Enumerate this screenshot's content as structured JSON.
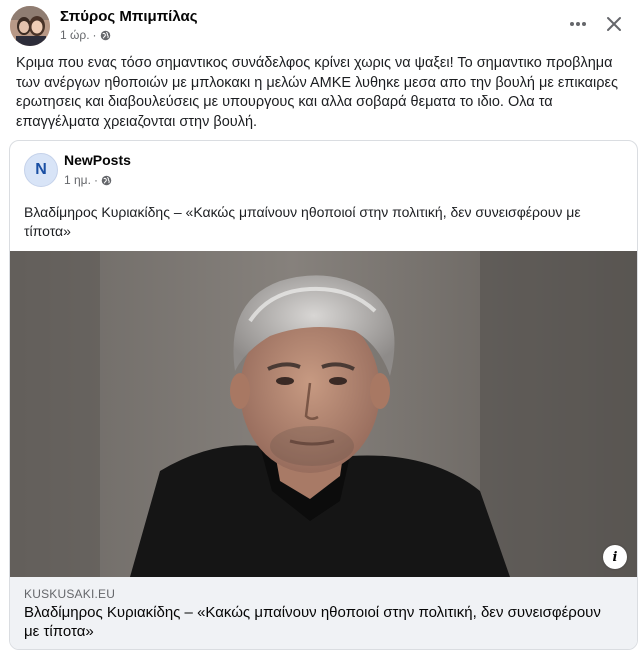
{
  "post": {
    "author": "Σπύρος Μπιμπίλας",
    "time": "1 ώρ.",
    "separator": "·",
    "text": "Κριμα που ενας τόσο σημαντικος συνάδελφος κρίνει χωρις να ψαξει! Το σημαντικο προβλημα των ανέργων ηθοποιών με μπλοκακι η μελών ΑΜΚΕ λυθηκε μεσα απο την βουλή με επικαιρες ερωτησεις και διαβουλεύσεις με υπουργους και αλλα σοβαρά θεματα το ιδιο. Ολα τα επαγγέλματα χρειαζονται στην βουλή."
  },
  "shared": {
    "page_name": "NewPosts",
    "avatar_letter": "N",
    "time": "1 ημ.",
    "separator": "·",
    "text": "Βλαδίμηρος Κυριακίδης – «Κακώς μπαίνουν ηθοποιοί στην πολιτική, δεν συνεισφέρουν με τίποτα»",
    "link_domain": "KUSKUSAKI.EU",
    "link_title": "Βλαδίμηρος Κυριακίδης – «Κακώς μπαίνουν ηθοποιοί στην πολιτική, δεν συνεισφέρουν με τίποτα»",
    "info_glyph": "i"
  },
  "icons": {
    "globe": "globe-icon",
    "more": "more-options-icon",
    "close": "close-icon",
    "info": "info-icon"
  },
  "colors": {
    "secondary_text": "#65676b",
    "footer_bg": "#f0f2f5",
    "border": "#dadde1"
  }
}
